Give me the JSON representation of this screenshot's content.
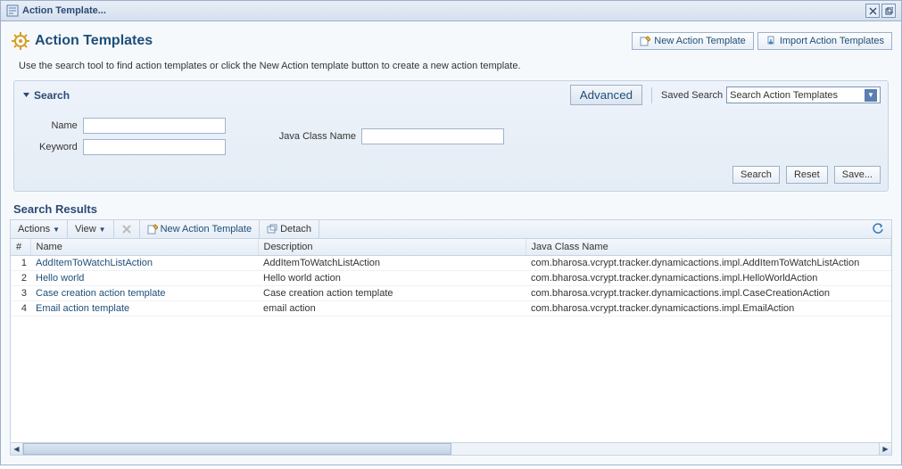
{
  "titlebar": {
    "title": "Action Template..."
  },
  "header": {
    "page_title": "Action Templates",
    "new_button": "New Action Template",
    "import_button": "Import Action Templates"
  },
  "instruction": "Use the search tool to find action templates or click the New Action template button to create a new action template.",
  "search": {
    "title": "Search",
    "advanced": "Advanced",
    "saved_label": "Saved Search",
    "saved_value": "Search Action Templates",
    "fields": {
      "name_label": "Name",
      "name_value": "",
      "keyword_label": "Keyword",
      "keyword_value": "",
      "class_label": "Java Class Name",
      "class_value": ""
    },
    "actions": {
      "search": "Search",
      "reset": "Reset",
      "save": "Save..."
    }
  },
  "results": {
    "title": "Search Results",
    "toolbar": {
      "actions": "Actions",
      "view": "View",
      "new": "New Action Template",
      "detach": "Detach"
    },
    "columns": {
      "num": "#",
      "name": "Name",
      "desc": "Description",
      "class": "Java Class Name"
    },
    "rows": [
      {
        "num": "1",
        "name": "AddItemToWatchListAction",
        "desc": "AddItemToWatchListAction",
        "class": "com.bharosa.vcrypt.tracker.dynamicactions.impl.AddItemToWatchListAction"
      },
      {
        "num": "2",
        "name": "Hello world",
        "desc": "Hello world action",
        "class": "com.bharosa.vcrypt.tracker.dynamicactions.impl.HelloWorldAction"
      },
      {
        "num": "3",
        "name": "Case creation action template",
        "desc": "Case creation action template",
        "class": "com.bharosa.vcrypt.tracker.dynamicactions.impl.CaseCreationAction"
      },
      {
        "num": "4",
        "name": "Email action template",
        "desc": "email action",
        "class": "com.bharosa.vcrypt.tracker.dynamicactions.impl.EmailAction"
      }
    ]
  }
}
